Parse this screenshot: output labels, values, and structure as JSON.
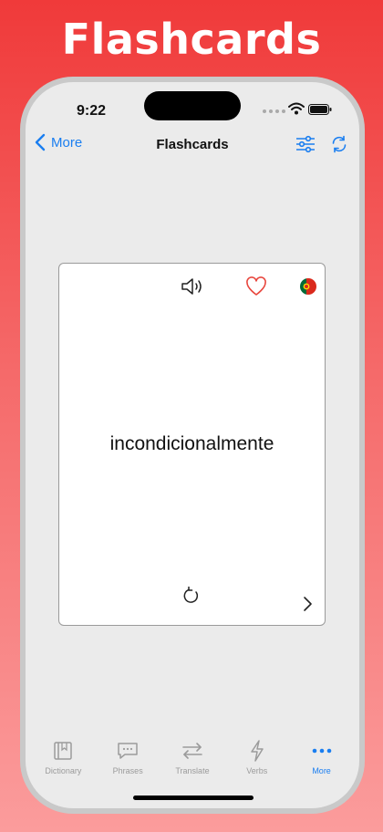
{
  "promo": {
    "title": "Flashcards"
  },
  "status_bar": {
    "time": "9:22"
  },
  "nav": {
    "back_label": "More",
    "title": "Flashcards"
  },
  "card": {
    "word": "incondicionalmente",
    "language_flag": "Portuguese flag"
  },
  "tabs": [
    {
      "label": "Dictionary",
      "icon": "book-icon",
      "active": false
    },
    {
      "label": "Phrases",
      "icon": "chat-bubble-icon",
      "active": false
    },
    {
      "label": "Translate",
      "icon": "arrows-swap-icon",
      "active": false
    },
    {
      "label": "Verbs",
      "icon": "bolt-icon",
      "active": false
    },
    {
      "label": "More",
      "icon": "more-dots-icon",
      "active": true
    }
  ],
  "colors": {
    "accent": "#1a7ef0",
    "heart": "#e8453c",
    "background_top": "#f03a3a"
  }
}
